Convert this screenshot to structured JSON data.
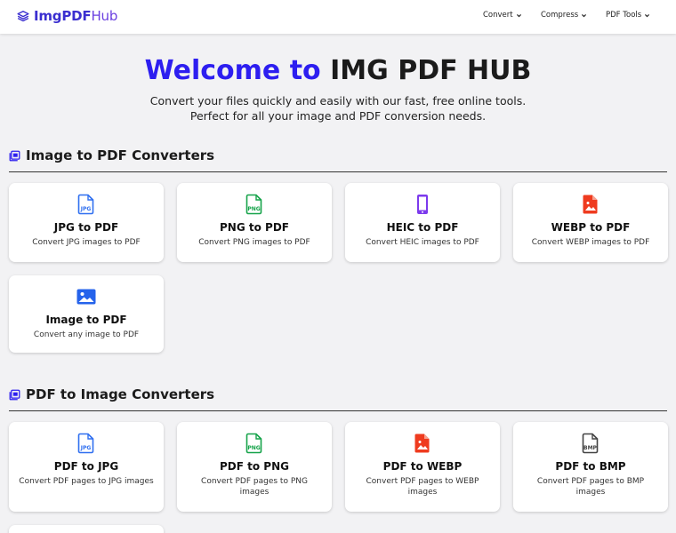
{
  "brand": {
    "name_bold": "ImgPDF",
    "name_light": "Hub",
    "color": "#3b2fd0"
  },
  "nav": {
    "items": [
      {
        "label": "Convert"
      },
      {
        "label": "Compress"
      },
      {
        "label": "PDF Tools"
      }
    ]
  },
  "hero": {
    "title_accent": "Welcome to",
    "title_rest": " IMG PDF HUB",
    "subtitle": "Convert your files quickly and easily with our fast, free online tools. Perfect for all your image and PDF conversion needs."
  },
  "sections": [
    {
      "title": "Image to PDF Converters",
      "cards": [
        {
          "title": "JPG to PDF",
          "desc": "Convert JPG images to PDF",
          "icon": "jpg-file-icon"
        },
        {
          "title": "PNG to PDF",
          "desc": "Convert PNG images to PDF",
          "icon": "png-file-icon"
        },
        {
          "title": "HEIC to PDF",
          "desc": "Convert HEIC images to PDF",
          "icon": "phone-icon"
        },
        {
          "title": "WEBP to PDF",
          "desc": "Convert WEBP images to PDF",
          "icon": "image-file-icon"
        },
        {
          "title": "Image to PDF",
          "desc": "Convert any image to PDF",
          "icon": "image-icon"
        }
      ]
    },
    {
      "title": "PDF to Image Converters",
      "cards": [
        {
          "title": "PDF to JPG",
          "desc": "Convert PDF pages to JPG images",
          "icon": "jpg-file-icon"
        },
        {
          "title": "PDF to PNG",
          "desc": "Convert PDF pages to PNG images",
          "icon": "png-file-icon"
        },
        {
          "title": "PDF to WEBP",
          "desc": "Convert PDF pages to WEBP images",
          "icon": "image-file-icon"
        },
        {
          "title": "PDF to BMP",
          "desc": "Convert PDF pages to BMP images",
          "icon": "bmp-file-icon"
        }
      ]
    }
  ],
  "icon_text": {
    "jpg": "JPG",
    "png": "PNG",
    "bmp": "BMP"
  },
  "colors": {
    "accent": "#2d1ef0",
    "jpg_blue": "#2f6ff0",
    "png_green": "#16a34a",
    "heic_purple": "#7c3aed",
    "webp_red": "#ef3b1f",
    "image_blue": "#2563eb",
    "bmp_gray": "#444444"
  }
}
